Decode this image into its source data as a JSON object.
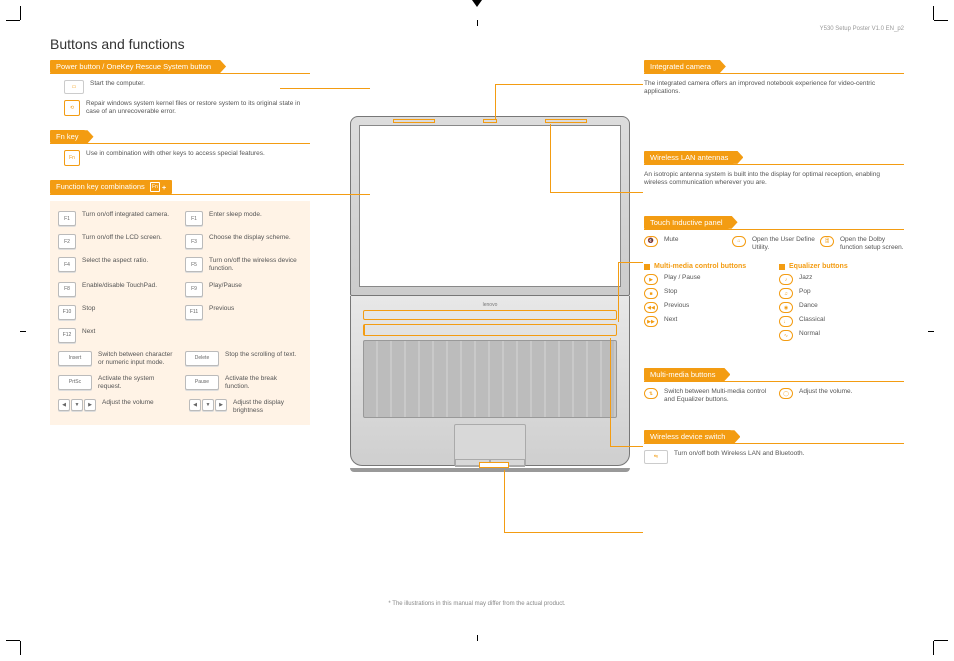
{
  "doc_id": "Y530 Setup Poster V1.0 EN_p2",
  "title": "Buttons and functions",
  "left": {
    "power": {
      "label": "Power button / OneKey Rescue System button",
      "items": [
        "Start the computer.",
        "Repair windows system kernel files or restore system to its original state in case of an unrecoverable error."
      ]
    },
    "fn_key": {
      "label": "Fn key",
      "desc": "Use in combination with other keys to access special features."
    },
    "fn_combos": {
      "label": "Function key combinations",
      "keys": [
        {
          "k": "F1",
          "d": "Turn on/off integrated camera."
        },
        {
          "k": "F1",
          "d": "Enter sleep mode."
        },
        {
          "k": "F2",
          "d": "Turn on/off the LCD screen."
        },
        {
          "k": "F3",
          "d": "Choose the display scheme."
        },
        {
          "k": "F4",
          "d": "Select the aspect ratio."
        },
        {
          "k": "F5",
          "d": "Turn on/off the wireless device function."
        },
        {
          "k": "F8",
          "d": "Enable/disable TouchPad."
        },
        {
          "k": "F9",
          "d": "Play/Pause"
        },
        {
          "k": "F10",
          "d": "Stop"
        },
        {
          "k": "F11",
          "d": "Previous"
        },
        {
          "k": "F12",
          "d": "Next"
        },
        {
          "k": "",
          "d": ""
        },
        {
          "k": "Insert",
          "d": "Switch between character or numeric input mode.",
          "wide": true
        },
        {
          "k": "Delete",
          "d": "Stop the scrolling of text.",
          "wide": true
        },
        {
          "k": "PrtSc",
          "d": "Activate the system request.",
          "wide": true
        },
        {
          "k": "Pause",
          "d": "Activate the break function.",
          "wide": true
        }
      ],
      "arrows": [
        {
          "d": "Adjust the volume"
        },
        {
          "d": "Adjust the display brightness"
        }
      ]
    }
  },
  "right": {
    "camera": {
      "label": "Integrated camera",
      "desc": "The integrated camera offers an improved notebook experience for video-centric applications."
    },
    "wlan": {
      "label": "Wireless LAN antennas",
      "desc": "An isotropic antenna system is built into the display for optimal reception, enabling wireless communication wherever you are."
    },
    "touch": {
      "label": "Touch Inductive panel",
      "top_row": [
        {
          "i": "🔇",
          "d": "Mute"
        },
        {
          "i": "⌂",
          "d": "Open the User Define Utility."
        },
        {
          "i": "🎚",
          "d": "Open the Dolby function setup screen."
        }
      ],
      "mm_head": "Multi-media control buttons",
      "eq_head": "Equalizer buttons",
      "mm": [
        {
          "i": "▶",
          "d": "Play / Pause"
        },
        {
          "i": "■",
          "d": "Stop"
        },
        {
          "i": "◀◀",
          "d": "Previous"
        },
        {
          "i": "▶▶",
          "d": "Next"
        }
      ],
      "eq": [
        {
          "i": "♪",
          "d": "Jazz"
        },
        {
          "i": "♫",
          "d": "Pop"
        },
        {
          "i": "◉",
          "d": "Dance"
        },
        {
          "i": "♩",
          "d": "Classical"
        },
        {
          "i": "∿",
          "d": "Normal"
        }
      ]
    },
    "mmbuttons": {
      "label": "Multi-media buttons",
      "items": [
        {
          "i": "⇅",
          "d": "Switch between Multi-media control and Equalizer buttons."
        },
        {
          "i": "◯",
          "d": "Adjust the volume."
        }
      ]
    },
    "wireless_switch": {
      "label": "Wireless device switch",
      "desc": "Turn on/off both Wireless LAN and Bluetooth."
    }
  },
  "footnote": "* The illustrations in this manual may differ from the actual product."
}
